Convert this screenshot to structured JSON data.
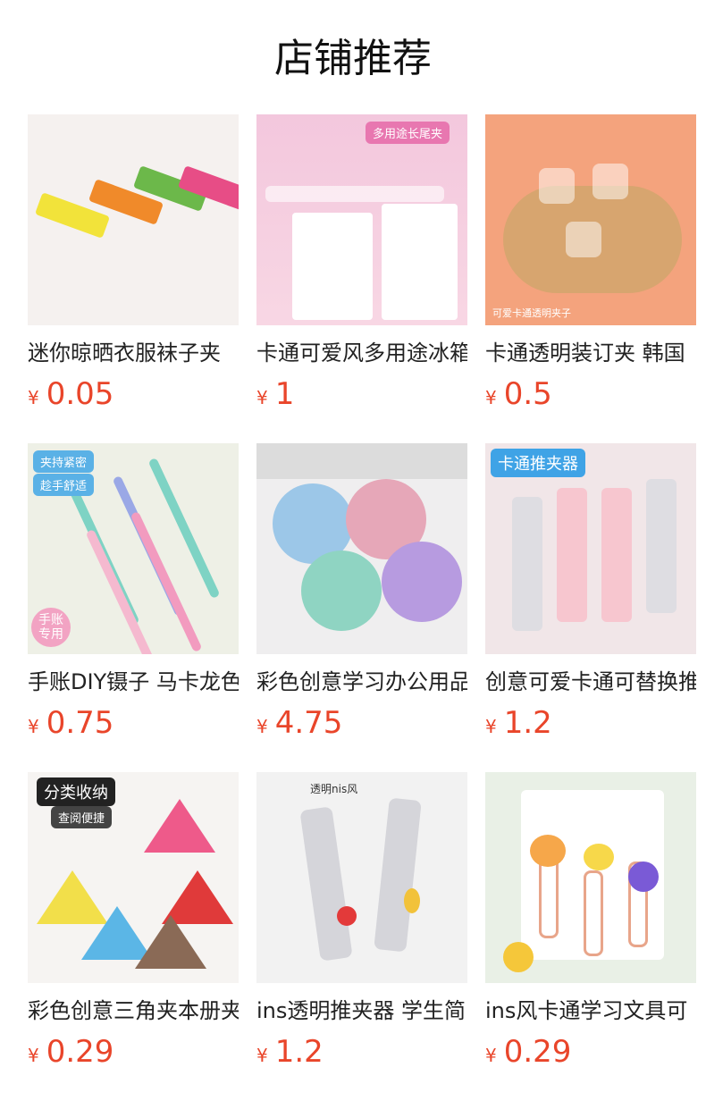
{
  "header": {
    "title": "店铺推荐"
  },
  "currency_symbol": "¥",
  "products": [
    {
      "name": "迷你晾晒衣服袜子夹",
      "price": "0.05"
    },
    {
      "name": "卡通可爱风多用途冰箱",
      "price": "1"
    },
    {
      "name": "卡通透明装订夹 韩国",
      "price": "0.5"
    },
    {
      "name": "手账DIY镊子 马卡龙色",
      "price": "0.75"
    },
    {
      "name": "彩色创意学习办公用品",
      "price": "4.75"
    },
    {
      "name": "创意可爱卡通可替换推",
      "price": "1.2"
    },
    {
      "name": "彩色创意三角夹本册夹",
      "price": "0.29"
    },
    {
      "name": "ins透明推夹器 学生简",
      "price": "1.2"
    },
    {
      "name": "ins风卡通学习文具可",
      "price": "0.29"
    }
  ],
  "image_text": {
    "p2": "多用途长尾夹",
    "p3": "可爱卡通透明夹子",
    "p4_a": "夹持紧密",
    "p4_b": "趁手舒适",
    "p4_c": "手账专用",
    "p6": "卡通推夹器",
    "p7_a": "分类收纳",
    "p7_b": "查阅便捷",
    "p8": "透明nis风"
  }
}
